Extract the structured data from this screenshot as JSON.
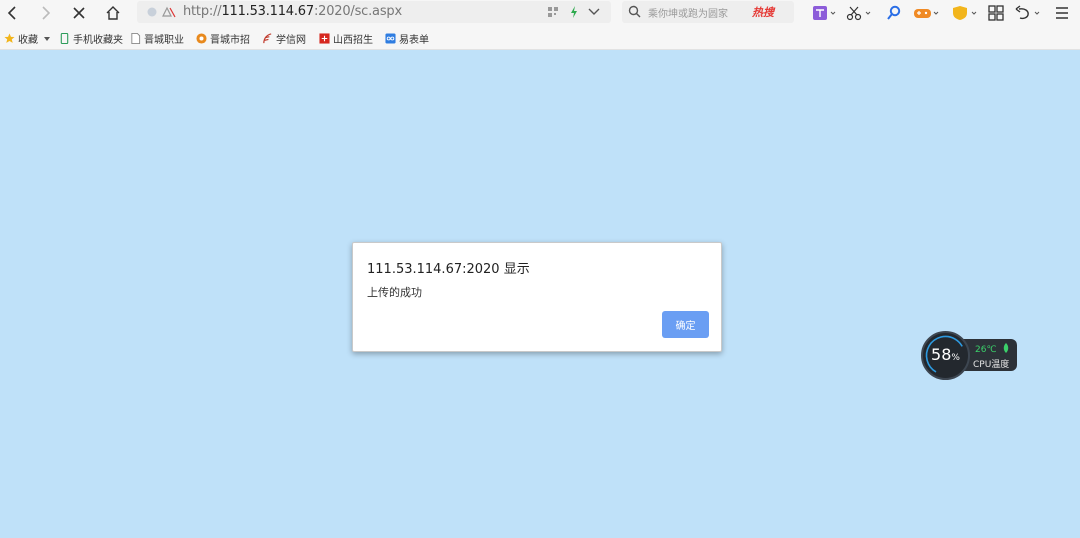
{
  "browser": {
    "url_scheme_host_prefix": "http://",
    "url_host": "111.53.114.67",
    "url_path": ":2020/sc.aspx",
    "search_placeholder": "乘你坤或跑为圆家",
    "hot_label": "热搜",
    "accent_color": "#e53935"
  },
  "bookmarks": [
    {
      "label": "收藏",
      "icon": "star-icon"
    },
    {
      "label": "手机收藏夹",
      "icon": "phone-icon"
    },
    {
      "label": "晋城职业",
      "icon": "page-icon"
    },
    {
      "label": "晋城市招",
      "icon": "badge-icon"
    },
    {
      "label": "学信网",
      "icon": "feather-icon"
    },
    {
      "label": "山西招生",
      "icon": "red-square-icon"
    },
    {
      "label": "易表单",
      "icon": "blue-square-icon"
    }
  ],
  "dialog": {
    "title": "111.53.114.67:2020 显示",
    "message": "上传的成功",
    "ok_label": "确定"
  },
  "cpu_widget": {
    "load": "58",
    "load_unit": "%",
    "temperature": "26℃",
    "label": "CPU温度"
  }
}
